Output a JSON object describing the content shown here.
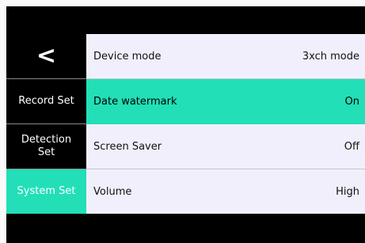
{
  "sidebar": {
    "back_glyph": "<",
    "items": [
      {
        "label": "Record Set",
        "active": false
      },
      {
        "label": "Detection\nSet",
        "active": false
      },
      {
        "label": "System Set",
        "active": true
      }
    ]
  },
  "settings": [
    {
      "name": "Device mode",
      "value": "3xch mode"
    },
    {
      "name": "Date watermark",
      "value": "On"
    },
    {
      "name": "Screen Saver",
      "value": "Off"
    },
    {
      "name": "Volume",
      "value": "High"
    }
  ],
  "colors": {
    "accent": "#22dfb7",
    "background": "#000000",
    "row_background": "#f1effb"
  },
  "icons": {
    "back": "back-chevron-icon"
  }
}
